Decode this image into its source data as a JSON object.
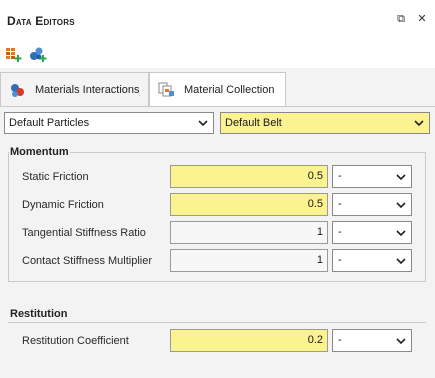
{
  "window": {
    "title": "Data Editors",
    "float_glyph": "⧉",
    "close_glyph": "✕"
  },
  "toolbar": {
    "icons": [
      "add-material-icon",
      "add-particles-icon"
    ]
  },
  "tabs": [
    {
      "label": "Materials Interactions",
      "icon": "materials-interactions-icon",
      "active": true
    },
    {
      "label": "Material Collection",
      "icon": "material-collection-icon",
      "active": false
    }
  ],
  "selectors": {
    "first": "Default Particles",
    "second": "Default Belt"
  },
  "momentum": {
    "title": "Momentum",
    "rows": [
      {
        "label": "Static Friction",
        "value": "0.5",
        "unit": "-",
        "highlight": true
      },
      {
        "label": "Dynamic Friction",
        "value": "0.5",
        "unit": "-",
        "highlight": true
      },
      {
        "label": "Tangential Stiffness Ratio",
        "value": "1",
        "unit": "-",
        "highlight": false
      },
      {
        "label": "Contact Stiffness Multiplier",
        "value": "1",
        "unit": "-",
        "highlight": false
      }
    ]
  },
  "restitution": {
    "title": "Restitution",
    "rows": [
      {
        "label": "Restitution Coefficient",
        "value": "0.2",
        "unit": "-",
        "highlight": true
      }
    ]
  },
  "colors": {
    "highlight": "#fbf38f",
    "panel_bg": "#f3f3f3",
    "border": "#c9c9c9"
  }
}
